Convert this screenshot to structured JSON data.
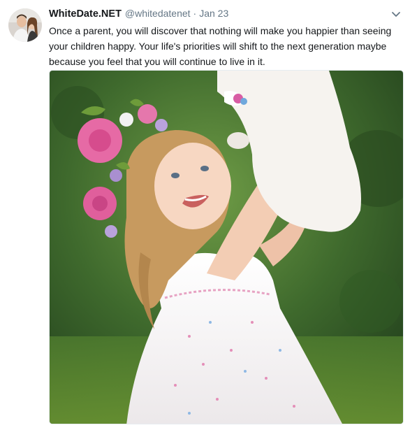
{
  "tweet": {
    "display_name": "WhiteDate.NET",
    "handle": "@whitedatenet",
    "separator": "·",
    "date": "Jan 23",
    "lines": [
      "Once a parent, you will discover that nothing will make you happier than seeing",
      "your children happy. Your life's priorities will shift to the next generation maybe",
      "because you feel that you will continue to live in it."
    ]
  },
  "icons": {
    "menu": "chevron-down-icon",
    "avatar": "profile-photo"
  },
  "colors": {
    "name": "#14171a",
    "secondary": "#657786",
    "chevron": "#657786",
    "photo_background": "#3f6a2d"
  }
}
